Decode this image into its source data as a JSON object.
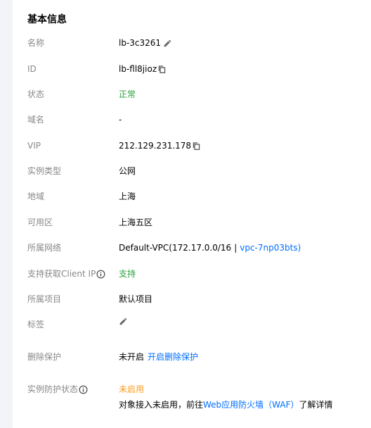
{
  "section_title": "基本信息",
  "fields": {
    "name": {
      "label": "名称",
      "value": "lb-3c3261"
    },
    "id": {
      "label": "ID",
      "value": "lb-fll8jioz"
    },
    "status": {
      "label": "状态",
      "value": "正常",
      "color": "#29a33d"
    },
    "domain": {
      "label": "域名",
      "value": "-"
    },
    "vip": {
      "label": "VIP",
      "value": "212.129.231.178"
    },
    "instance_type": {
      "label": "实例类型",
      "value": "公网"
    },
    "region": {
      "label": "地域",
      "value": "上海"
    },
    "zone": {
      "label": "可用区",
      "value": "上海五区"
    },
    "network": {
      "label": "所属网络",
      "value": "Default-VPC(172.17.0.0/16",
      "separator": "|",
      "vpc_link": "vpc-7np03bts",
      "close": ")"
    },
    "client_ip": {
      "label": "支持获取Client IP",
      "value": "支持",
      "color": "#29a33d"
    },
    "project": {
      "label": "所属项目",
      "value": "默认项目"
    },
    "tags": {
      "label": "标签"
    },
    "delete_protection": {
      "label": "删除保护",
      "value": "未开启",
      "action_link": "开启删除保护"
    },
    "instance_protection": {
      "label": "实例防护状态",
      "value": "未启用",
      "value_color": "#ff9c19",
      "note_prefix": "对象接入未启用，前往",
      "note_link": "Web应用防火墙（WAF）",
      "note_suffix": "了解详情"
    }
  },
  "icons": {
    "edit": "pencil-icon",
    "copy": "copy-icon",
    "info": "info-icon"
  },
  "colors": {
    "accent_link": "#006eff",
    "label": "#888888",
    "success": "#29a33d",
    "warning": "#ff9c19"
  }
}
